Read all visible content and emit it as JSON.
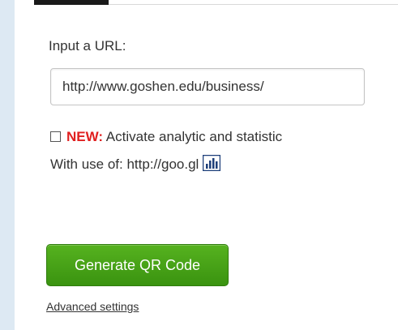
{
  "form": {
    "url_label": "Input a URL:",
    "url_value": "http://www.goshen.edu/business/",
    "checkbox_checked": false,
    "new_badge": "NEW:",
    "analytics_text": " Activate analytic and statistic",
    "with_use_text": "With use of: http://goo.gl",
    "generate_button_label": "Generate QR Code",
    "advanced_link": "Advanced settings"
  },
  "colors": {
    "page_background": "#dde9f3",
    "new_badge": "#e02020",
    "button_green": "#3f9a14",
    "chart_icon": "#1d3f7a"
  },
  "icons": {
    "analytics_icon": "bar-chart-icon"
  }
}
